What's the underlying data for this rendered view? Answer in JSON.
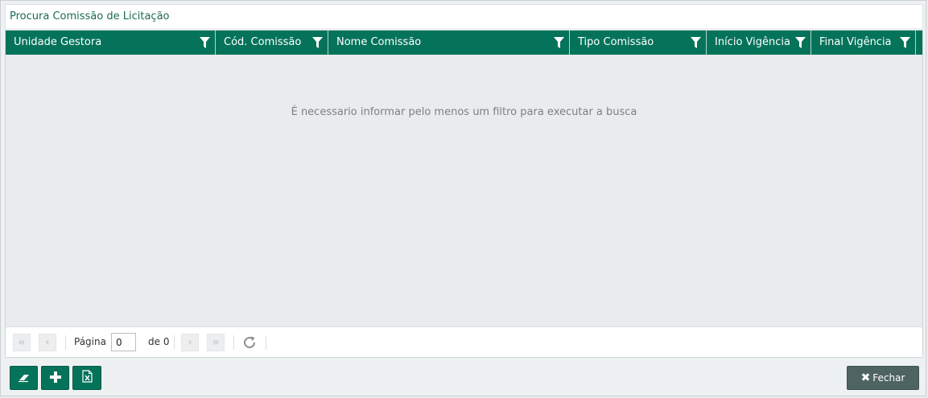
{
  "window": {
    "title": "Procura Comissão de Licitação"
  },
  "grid": {
    "columns": [
      {
        "label": "Unidade Gestora"
      },
      {
        "label": "Cód. Comissão"
      },
      {
        "label": "Nome Comissão"
      },
      {
        "label": "Tipo Comissão"
      },
      {
        "label": "Início Vigência"
      },
      {
        "label": "Final Vigência"
      }
    ],
    "empty_message": "É necessario informar pelo menos um filtro para executar a busca"
  },
  "pager": {
    "page_label": "Página",
    "page_value": "0",
    "of_label": "de 0"
  },
  "footer": {
    "close_label": "Fechar"
  },
  "colors": {
    "header_bg": "#04735a",
    "title_text": "#1c6b55",
    "close_button_bg": "#4e6462"
  },
  "icons": {
    "filter": "filter-funnel-icon",
    "first_page": "double-chevron-left-icon",
    "prev_page": "chevron-left-icon",
    "next_page": "chevron-right-icon",
    "last_page": "double-chevron-right-icon",
    "refresh": "refresh-icon",
    "clear": "eraser-icon",
    "add": "plus-icon",
    "export": "excel-export-icon",
    "close": "close-x-icon"
  }
}
